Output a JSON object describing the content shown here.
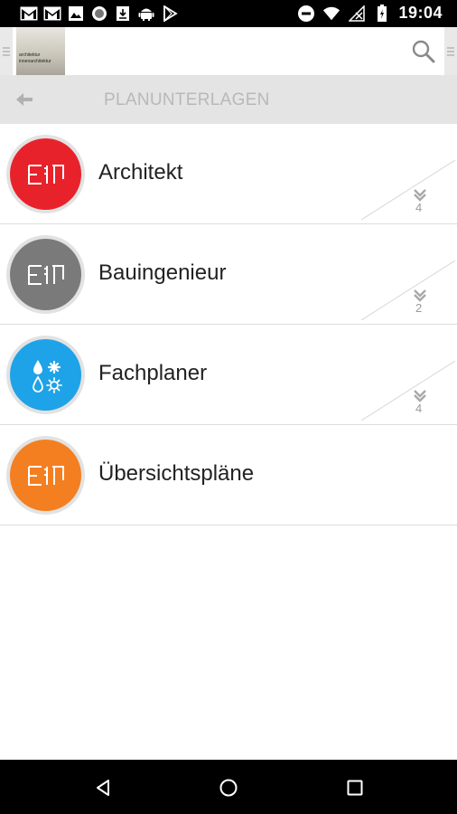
{
  "status_bar": {
    "time": "19:04",
    "left_icons": [
      "gmail-icon",
      "gmail-icon",
      "image-icon",
      "circle-icon",
      "download-icon",
      "android-icon",
      "play-store-icon"
    ],
    "right_icons": [
      "do-not-disturb-icon",
      "wifi-icon",
      "no-signal-icon",
      "battery-icon"
    ]
  },
  "app_bar": {
    "logo_lines": [
      "architektur",
      "innenarchitektur"
    ],
    "search_icon": "search-icon"
  },
  "sub_header": {
    "back_icon": "back-arrow-icon",
    "title": "PLANUNTERLAGEN"
  },
  "items": [
    {
      "label": "Architekt",
      "count": "4",
      "color": "#e8222b",
      "icon": "floorplan-icon"
    },
    {
      "label": "Bauingenieur",
      "count": "2",
      "color": "#7a7a7a",
      "icon": "floorplan-icon"
    },
    {
      "label": "Fachplaner",
      "count": "4",
      "color": "#1ea3e8",
      "icon": "utilities-icon"
    },
    {
      "label": "Übersichtspläne",
      "count": "",
      "color": "#f47f21",
      "icon": "floorplan-icon"
    }
  ],
  "nav_bar": [
    "back-triangle-icon",
    "home-circle-icon",
    "recents-square-icon"
  ]
}
